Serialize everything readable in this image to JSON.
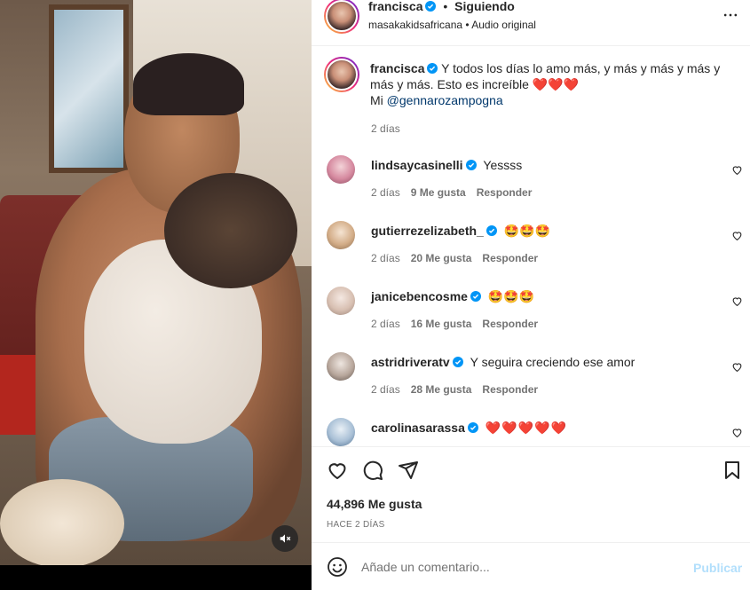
{
  "header": {
    "username": "francisca",
    "separator": "•",
    "follow_status": "Siguiendo",
    "subtitle": "masakakidsafricana • Audio original"
  },
  "caption": {
    "username": "francisca",
    "text": "Y todos los días lo amo más, y más y más y más y más y más. Esto es increíble ❤️❤️❤️",
    "line2_prefix": "Mi ",
    "mention": "@gennarozampogna",
    "time": "2 días"
  },
  "comments": [
    {
      "username": "lindsaycasinelli",
      "text": "Yessss",
      "time": "2 días",
      "likes": "9 Me gusta",
      "reply": "Responder"
    },
    {
      "username": "gutierrezelizabeth_",
      "text": "🤩🤩🤩",
      "time": "2 días",
      "likes": "20 Me gusta",
      "reply": "Responder"
    },
    {
      "username": "janicebencosme",
      "text": "🤩🤩🤩",
      "time": "2 días",
      "likes": "16 Me gusta",
      "reply": "Responder"
    },
    {
      "username": "astridriveratv",
      "text": "Y seguira creciendo ese amor",
      "time": "2 días",
      "likes": "28 Me gusta",
      "reply": "Responder"
    },
    {
      "username": "carolinasarassa",
      "text": "❤️❤️❤️❤️❤️",
      "time": "",
      "likes": "",
      "reply": ""
    }
  ],
  "actions": {
    "likes": "44,896 Me gusta",
    "posted": "HACE 2 DÍAS"
  },
  "compose": {
    "placeholder": "Añade un comentario...",
    "post_label": "Publicar"
  },
  "colors": {
    "verified": "#0095f6",
    "link": "#00376b",
    "muted_text": "#737373",
    "post_disabled": "#b2dffc"
  }
}
